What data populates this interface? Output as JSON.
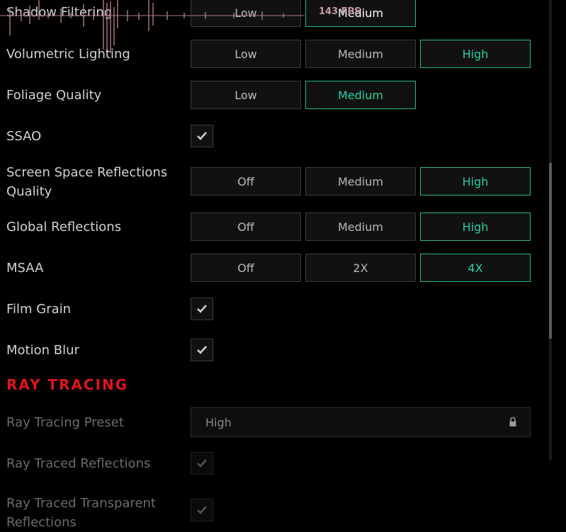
{
  "overlay": {
    "fps": "143 FPS"
  },
  "settings": [
    {
      "label": "Shadow Filtering",
      "options": [
        "Low",
        "Medium"
      ],
      "selected": 1
    },
    {
      "label": "Volumetric Lighting",
      "options": [
        "Low",
        "Medium",
        "High"
      ],
      "selected": 2
    },
    {
      "label": "Foliage Quality",
      "options": [
        "Low",
        "Medium"
      ],
      "selected": 1
    },
    {
      "label": "SSAO",
      "checked": true
    },
    {
      "label_line1": "Screen Space Reflections",
      "label_line2": "Quality",
      "options": [
        "Off",
        "Medium",
        "High"
      ],
      "selected": 2
    },
    {
      "label": "Global Reflections",
      "options": [
        "Off",
        "Medium",
        "High"
      ],
      "selected": 2
    },
    {
      "label": "MSAA",
      "options": [
        "Off",
        "2X",
        "4X"
      ],
      "selected": 2
    },
    {
      "label": "Film Grain",
      "checked": true
    },
    {
      "label": "Motion Blur",
      "checked": true
    }
  ],
  "ray_tracing": {
    "title": "RAY TRACING",
    "preset_label": "Ray Tracing Preset",
    "preset_value": "High",
    "reflections_label": "Ray Traced Reflections",
    "transparent_label_line1": "Ray Traced Transparent",
    "transparent_label_line2": "Reflections"
  },
  "icons": {
    "check": "checkmark-icon",
    "lock": "lock-icon"
  },
  "colors": {
    "accent": "#27d0a7",
    "section": "#e0141b",
    "fps_overlay": "#c79aa2"
  }
}
